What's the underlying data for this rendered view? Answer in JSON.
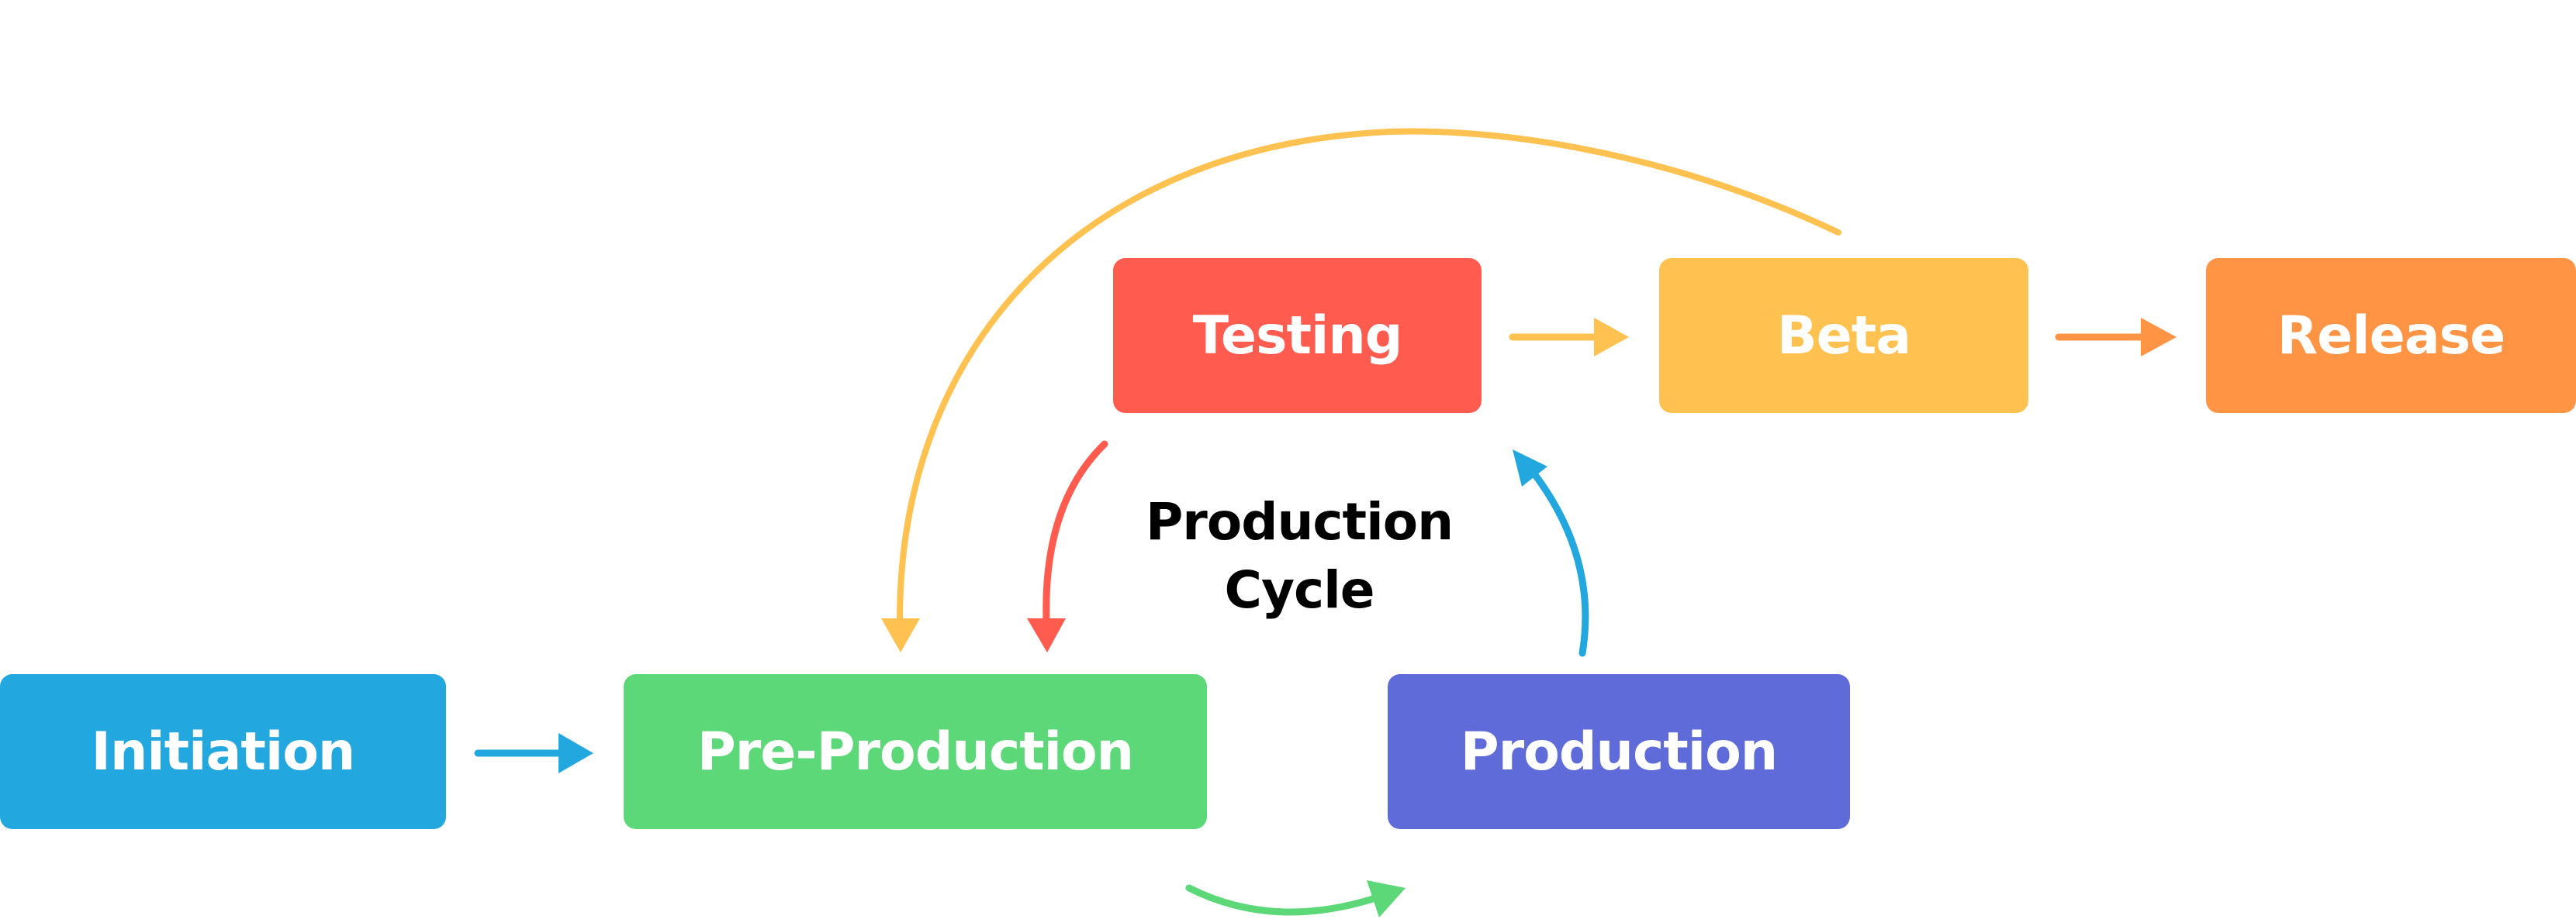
{
  "diagram": {
    "title": "Production Cycle",
    "center_label": {
      "line1": "Production",
      "line2": "Cycle"
    },
    "nodes": [
      {
        "id": "initiation",
        "label": "Initiation",
        "color": "#22a7df"
      },
      {
        "id": "pre-production",
        "label": "Pre-Production",
        "color": "#5dd879"
      },
      {
        "id": "production",
        "label": "Production",
        "color": "#5f6bd8"
      },
      {
        "id": "testing",
        "label": "Testing",
        "color": "#ff5b4e"
      },
      {
        "id": "beta",
        "label": "Beta",
        "color": "#ffc14f"
      },
      {
        "id": "release",
        "label": "Release",
        "color": "#ff9444"
      }
    ],
    "edges": [
      {
        "from": "initiation",
        "to": "pre-production",
        "color": "#22a7df",
        "style": "straight"
      },
      {
        "from": "pre-production",
        "to": "production",
        "color": "#5dd879",
        "style": "curved"
      },
      {
        "from": "production",
        "to": "testing",
        "color": "#22a7df",
        "style": "curved"
      },
      {
        "from": "testing",
        "to": "pre-production",
        "color": "#ff5b4e",
        "style": "curved"
      },
      {
        "from": "testing",
        "to": "beta",
        "color": "#ffc14f",
        "style": "straight"
      },
      {
        "from": "beta",
        "to": "pre-production",
        "color": "#ffc14f",
        "style": "curved"
      },
      {
        "from": "beta",
        "to": "release",
        "color": "#ff9444",
        "style": "straight"
      }
    ]
  }
}
